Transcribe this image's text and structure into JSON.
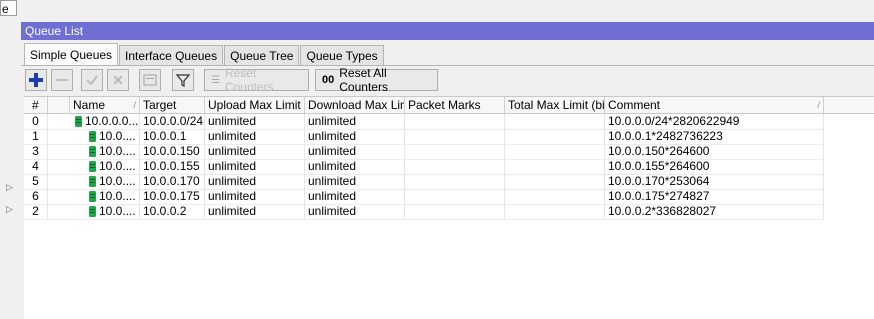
{
  "top_fragment": "e",
  "window": {
    "title": "Queue List"
  },
  "tabs": [
    {
      "label": "Simple Queues",
      "active": true
    },
    {
      "label": "Interface Queues",
      "active": false
    },
    {
      "label": "Queue Tree",
      "active": false
    },
    {
      "label": "Queue Types",
      "active": false
    }
  ],
  "toolbar": {
    "reset_counters": "Reset Counters",
    "reset_all_counters": "Reset All Counters",
    "reset_all_prefix": "00"
  },
  "columns": {
    "num": "#",
    "name": "Name",
    "target": "Target",
    "upload": "Upload Max Limit",
    "download": "Download Max Limit",
    "marks": "Packet Marks",
    "total": "Total Max Limit (bi...",
    "comment": "Comment"
  },
  "rows": [
    {
      "num": "0",
      "name": "10.0.0.0...",
      "target": "10.0.0.0/24",
      "upload": "unlimited",
      "download": "unlimited",
      "marks": "",
      "total": "",
      "comment": "10.0.0.0/24*2820622949"
    },
    {
      "num": "1",
      "name": "10.0....",
      "target": "10.0.0.1",
      "upload": "unlimited",
      "download": "unlimited",
      "marks": "",
      "total": "",
      "comment": "10.0.0.1*2482736223"
    },
    {
      "num": "3",
      "name": "10.0....",
      "target": "10.0.0.150",
      "upload": "unlimited",
      "download": "unlimited",
      "marks": "",
      "total": "",
      "comment": "10.0.0.150*264600"
    },
    {
      "num": "4",
      "name": "10.0....",
      "target": "10.0.0.155",
      "upload": "unlimited",
      "download": "unlimited",
      "marks": "",
      "total": "",
      "comment": "10.0.0.155*264600"
    },
    {
      "num": "5",
      "name": "10.0....",
      "target": "10.0.0.170",
      "upload": "unlimited",
      "download": "unlimited",
      "marks": "",
      "total": "",
      "comment": "10.0.0.170*253064"
    },
    {
      "num": "6",
      "name": "10.0....",
      "target": "10.0.0.175",
      "upload": "unlimited",
      "download": "unlimited",
      "marks": "",
      "total": "",
      "comment": "10.0.0.175*274827"
    },
    {
      "num": "2",
      "name": "10.0....",
      "target": "10.0.0.2",
      "upload": "unlimited",
      "download": "unlimited",
      "marks": "",
      "total": "",
      "comment": "10.0.0.2*336828027"
    }
  ],
  "colors": {
    "title_bar": "#6e6ed3",
    "queue_icon": "#1fa64a",
    "add_icon": "#1a3fa8"
  }
}
